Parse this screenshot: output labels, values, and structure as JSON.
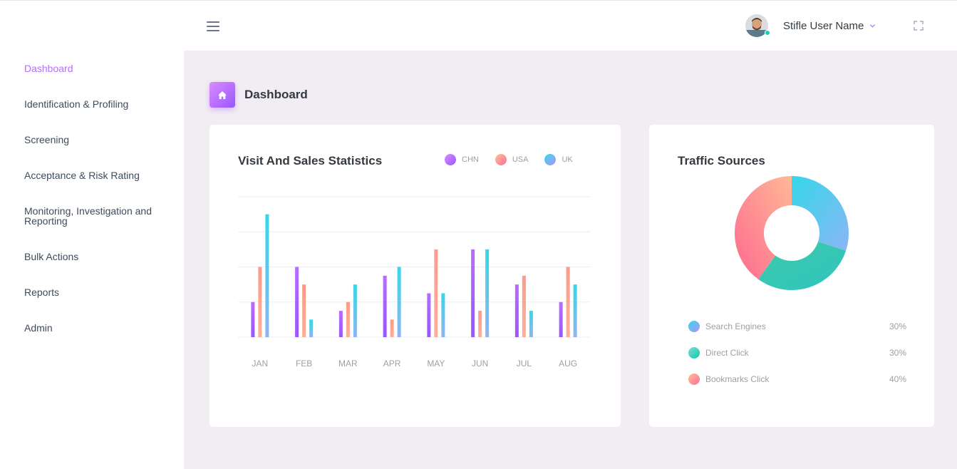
{
  "header": {
    "user_name": "Stifle User Name"
  },
  "sidebar": {
    "items": [
      {
        "label": "Dashboard",
        "active": true
      },
      {
        "label": "Identification & Profiling"
      },
      {
        "label": "Screening"
      },
      {
        "label": "Acceptance & Risk Rating"
      },
      {
        "label": "Monitoring, Investigation and Reporting"
      },
      {
        "label": "Bulk Actions"
      },
      {
        "label": "Reports"
      },
      {
        "label": "Admin"
      }
    ]
  },
  "page": {
    "title": "Dashboard",
    "icon": "home-icon"
  },
  "colors": {
    "accent": "#b66dff",
    "chn": [
      "#da8cff",
      "#9a55ff"
    ],
    "usa": [
      "#ffbf96",
      "#fe7096"
    ],
    "uk": [
      "#90caf9",
      "#047edf"
    ],
    "search_engines": [
      "#36d7e8",
      "#b194fa"
    ],
    "direct_click": [
      "#84d9d2",
      "#07cdae"
    ],
    "bookmarks_click": [
      "#ffbf96",
      "#fe7096"
    ]
  },
  "chart_data": [
    {
      "type": "bar",
      "title": "Visit And Sales Statistics",
      "categories": [
        "JAN",
        "FEB",
        "MAR",
        "APR",
        "MAY",
        "JUN",
        "JUL",
        "AUG"
      ],
      "series": [
        {
          "name": "CHN",
          "values": [
            20,
            40,
            15,
            35,
            25,
            50,
            30,
            20
          ]
        },
        {
          "name": "USA",
          "values": [
            40,
            30,
            20,
            10,
            50,
            15,
            35,
            40
          ]
        },
        {
          "name": "UK",
          "values": [
            70,
            10,
            30,
            40,
            25,
            50,
            15,
            30
          ]
        }
      ],
      "ylim": [
        0,
        80
      ],
      "grid": true,
      "legend": "top-right"
    },
    {
      "type": "pie",
      "title": "Traffic Sources",
      "labels": [
        "Search Engines",
        "Direct Click",
        "Bookmarks Click"
      ],
      "values": [
        30,
        30,
        40
      ],
      "value_labels": [
        "30%",
        "30%",
        "40%"
      ],
      "donut": true
    }
  ]
}
